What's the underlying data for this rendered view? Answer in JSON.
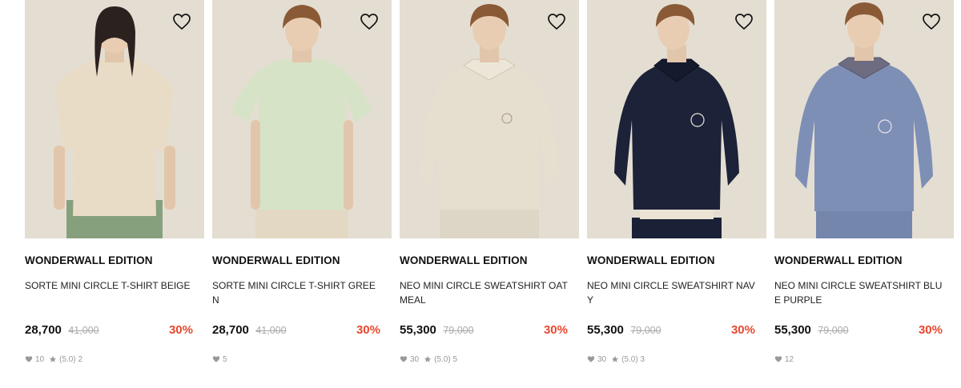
{
  "colors": {
    "accent_discount": "#e8472f",
    "brand_text": "#111111",
    "strike_price": "#aaaaaa",
    "meta_text": "#999999",
    "photo_background": "#e4ded2"
  },
  "icons": {
    "wishlist": "heart-outline-icon",
    "like_count": "heart-icon",
    "rating": "star-icon"
  },
  "products": [
    {
      "brand": "WONDERWALL EDITION",
      "name": "SORTE MINI CIRCLE T-SHIRT BEIGE",
      "price": "28,700",
      "original_price": "41,000",
      "discount": "30%",
      "likes": "10",
      "rating": "(5.0) 2",
      "garment_color": "#e9dcc6",
      "pants_color": "#86a07e"
    },
    {
      "brand": "WONDERWALL EDITION",
      "name": "SORTE MINI CIRCLE T-SHIRT GREEN",
      "price": "28,700",
      "original_price": "41,000",
      "discount": "30%",
      "likes": "5",
      "rating": "",
      "garment_color": "#d7e3c6",
      "pants_color": "#e3d8c4"
    },
    {
      "brand": "WONDERWALL EDITION",
      "name": "NEO MINI CIRCLE SWEATSHIRT OATMEAL",
      "price": "55,300",
      "original_price": "79,000",
      "discount": "30%",
      "likes": "30",
      "rating": "(5.0) 5",
      "garment_color": "#e6dfcf",
      "pants_color": "#ddd5c5"
    },
    {
      "brand": "WONDERWALL EDITION",
      "name": "NEO MINI CIRCLE SWEATSHIRT NAVY",
      "price": "55,300",
      "original_price": "79,000",
      "discount": "30%",
      "likes": "30",
      "rating": "(5.0) 3",
      "garment_color": "#1c2238",
      "pants_color": "#1a2036"
    },
    {
      "brand": "WONDERWALL EDITION",
      "name": "NEO MINI CIRCLE SWEATSHIRT BLUE PURPLE",
      "price": "55,300",
      "original_price": "79,000",
      "discount": "30%",
      "likes": "12",
      "rating": "",
      "garment_color": "#7e8fb6",
      "pants_color": "#7586ad"
    }
  ]
}
